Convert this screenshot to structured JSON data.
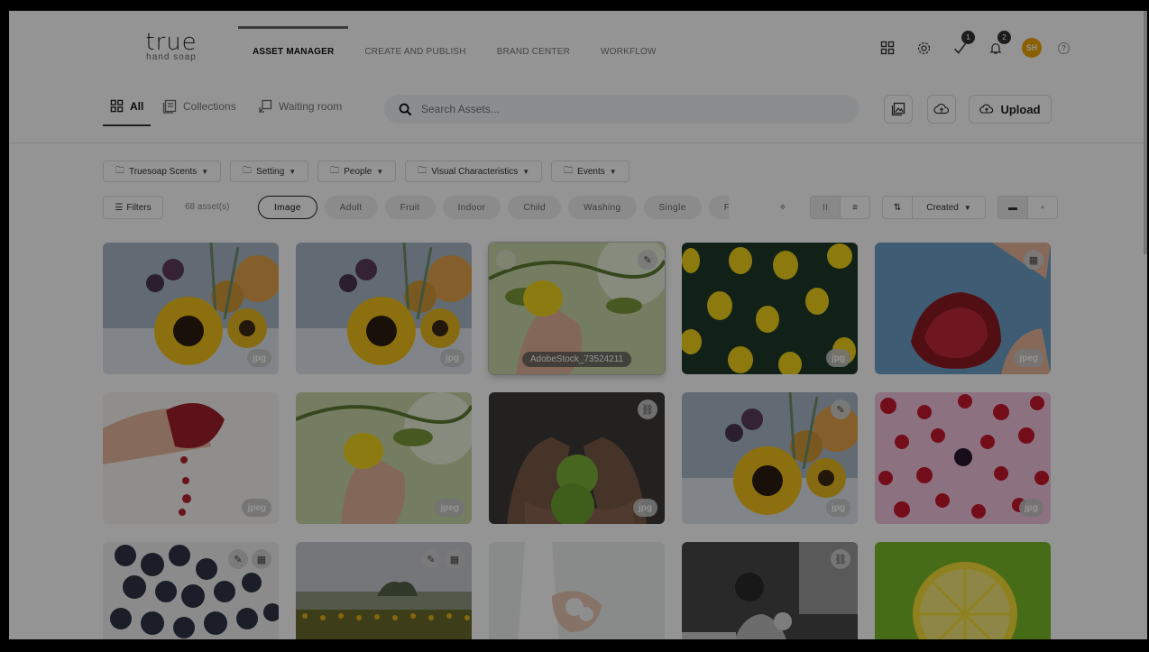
{
  "brand": {
    "word": "true",
    "sub": "hand soap"
  },
  "nav": [
    {
      "label": "ASSET MANAGER",
      "active": true
    },
    {
      "label": "CREATE AND PUBLISH"
    },
    {
      "label": "BRAND CENTER"
    },
    {
      "label": "WORKFLOW"
    }
  ],
  "header": {
    "badge_tasks": "1",
    "badge_notifications": "2",
    "avatar": "SH",
    "help": "?"
  },
  "views": {
    "all": "All",
    "collections": "Collections",
    "waiting": "Waiting room"
  },
  "search": {
    "placeholder": "Search Assets..."
  },
  "upload_label": "Upload",
  "facets": [
    "Truesoap Scents",
    "Setting",
    "People",
    "Visual Characteristics",
    "Events"
  ],
  "filters_label": "Filters",
  "asset_count": "68 asset(s)",
  "chips": [
    {
      "label": "Image",
      "active": true
    },
    {
      "label": "Adult"
    },
    {
      "label": "Fruit"
    },
    {
      "label": "Indoor"
    },
    {
      "label": "Child"
    },
    {
      "label": "Washing"
    },
    {
      "label": "Single"
    },
    {
      "label": "Fa"
    }
  ],
  "sort_label": "Created",
  "assets": [
    {
      "ext": "jpg",
      "scene": "sunflower"
    },
    {
      "ext": "jpg",
      "scene": "sunflower"
    },
    {
      "ext": "",
      "scene": "lemon-hand",
      "filename": "AdobeStock_73524211",
      "selected": true
    },
    {
      "ext": "jpg",
      "scene": "lemons-green"
    },
    {
      "ext": "jpeg",
      "scene": "pomegranate-blue"
    },
    {
      "ext": "jpeg",
      "scene": "pomegranate-white"
    },
    {
      "ext": "jpeg",
      "scene": "lemon-hand"
    },
    {
      "ext": "jpg",
      "scene": "limes"
    },
    {
      "ext": "jpg",
      "scene": "sunflower"
    },
    {
      "ext": "jpg",
      "scene": "raspberries"
    },
    {
      "ext": "",
      "scene": "blueberries"
    },
    {
      "ext": "",
      "scene": "field"
    },
    {
      "ext": "",
      "scene": "washing"
    },
    {
      "ext": "",
      "scene": "bw-family"
    },
    {
      "ext": "",
      "scene": "lemon-slice"
    }
  ]
}
